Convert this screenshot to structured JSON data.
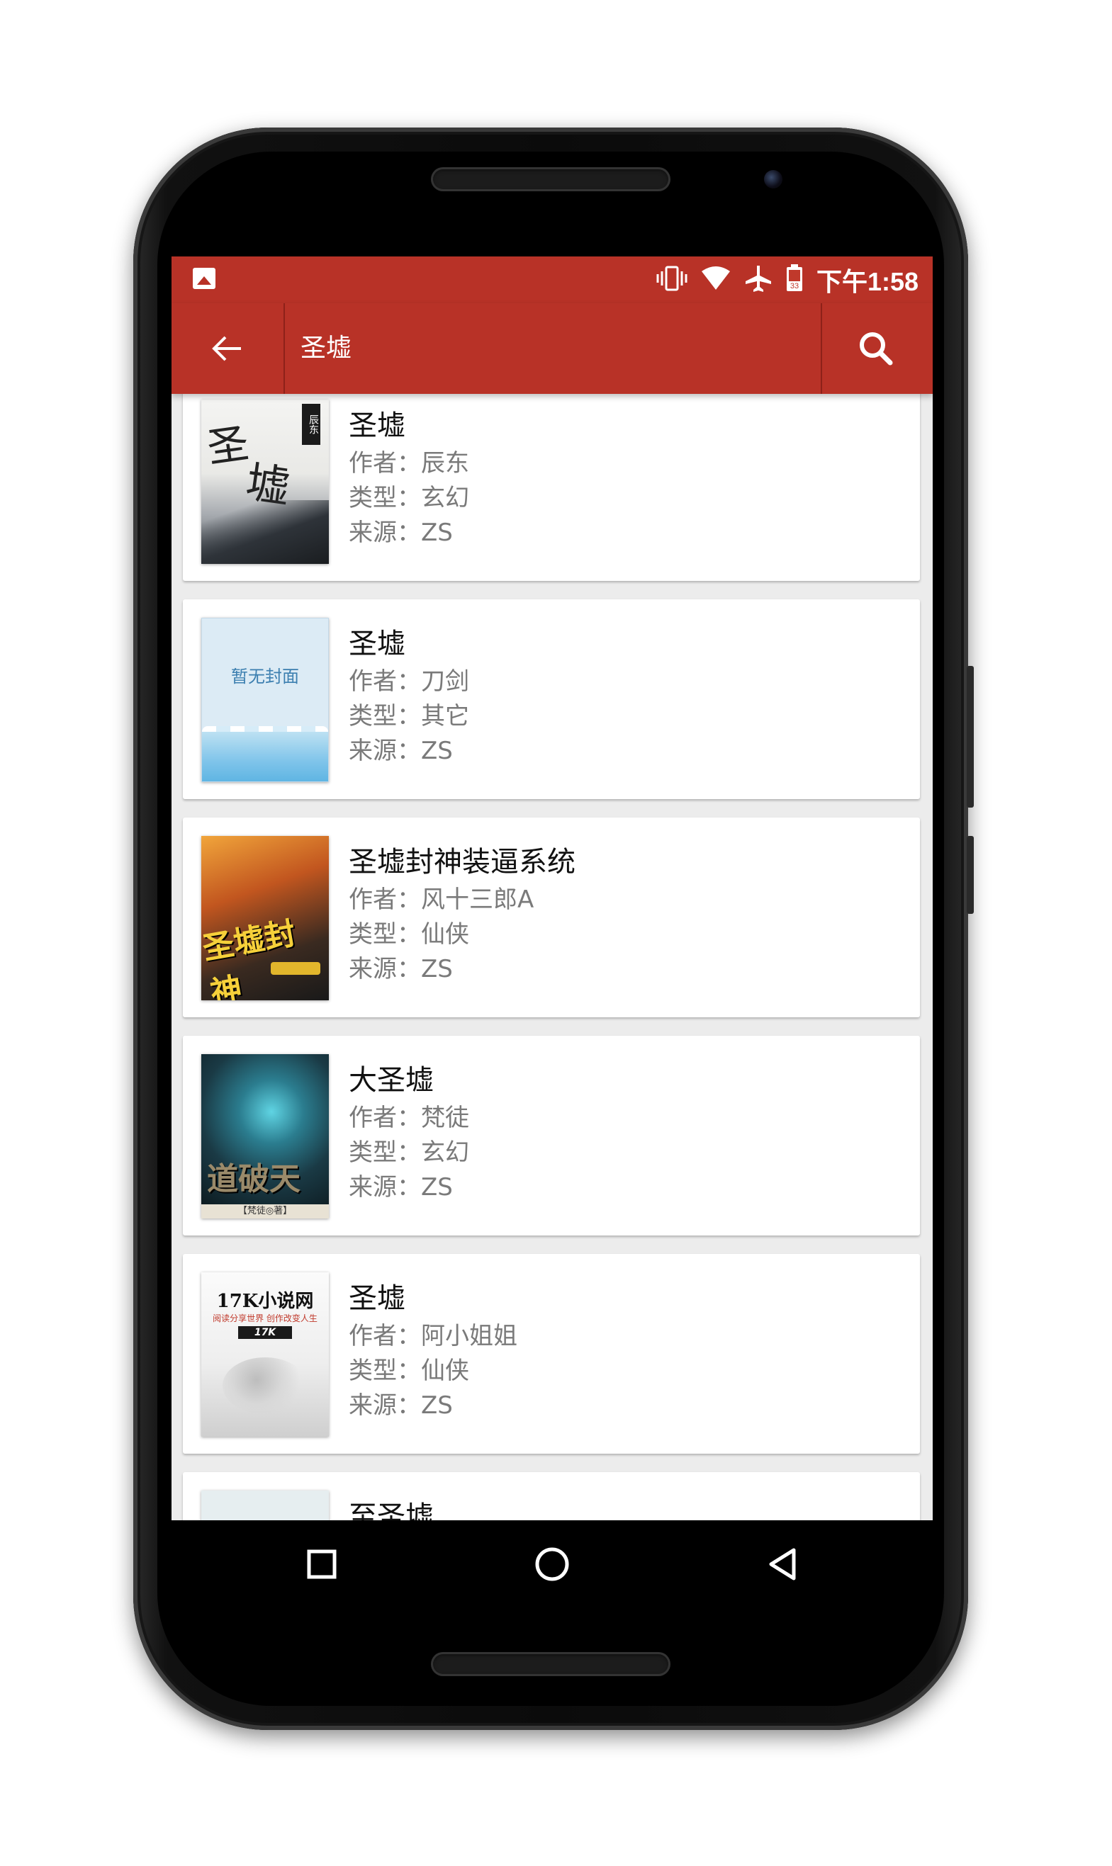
{
  "status_bar": {
    "time": "下午1:58",
    "calendar_day": "33",
    "icons": [
      "image-notification-icon",
      "vibrate-icon",
      "wifi-icon",
      "airplane-mode-icon",
      "battery-icon"
    ]
  },
  "toolbar": {
    "query": "圣墟",
    "back_icon": "arrow-left-icon",
    "search_icon": "search-icon"
  },
  "results": [
    {
      "title": "圣墟",
      "author": "作者：辰东",
      "genre": "类型：玄幻",
      "source": "来源：ZS",
      "cover": {
        "text": "圣墟",
        "tag": "辰东"
      }
    },
    {
      "title": "圣墟",
      "author": "作者：刀剑",
      "genre": "类型：其它",
      "source": "来源：ZS",
      "cover": {
        "text": "暂无封面"
      }
    },
    {
      "title": "圣墟封神装逼系统",
      "author": "作者：风十三郎A",
      "genre": "类型：仙侠",
      "source": "来源：ZS",
      "cover": {
        "text": "圣墟封神"
      }
    },
    {
      "title": "大圣墟",
      "author": "作者：梵徒",
      "genre": "类型：玄幻",
      "source": "来源：ZS",
      "cover": {
        "text": "道破天荒",
        "foot": "【梵徒◎著】"
      }
    },
    {
      "title": "圣墟",
      "author": "作者：阿小姐姐",
      "genre": "类型：仙侠",
      "source": "来源：ZS",
      "cover": {
        "text": "17K小说网",
        "slogan": "阅读分享世界 创作改变人生",
        "logo": "17K"
      }
    },
    {
      "title": "至圣墟"
    }
  ],
  "nav_bar": {
    "recents_icon": "square-icon",
    "home_icon": "circle-icon",
    "back_icon": "triangle-back-icon"
  },
  "colors": {
    "primary": "#b83227",
    "background": "#ececec",
    "meta_text": "#7a7a7a"
  }
}
